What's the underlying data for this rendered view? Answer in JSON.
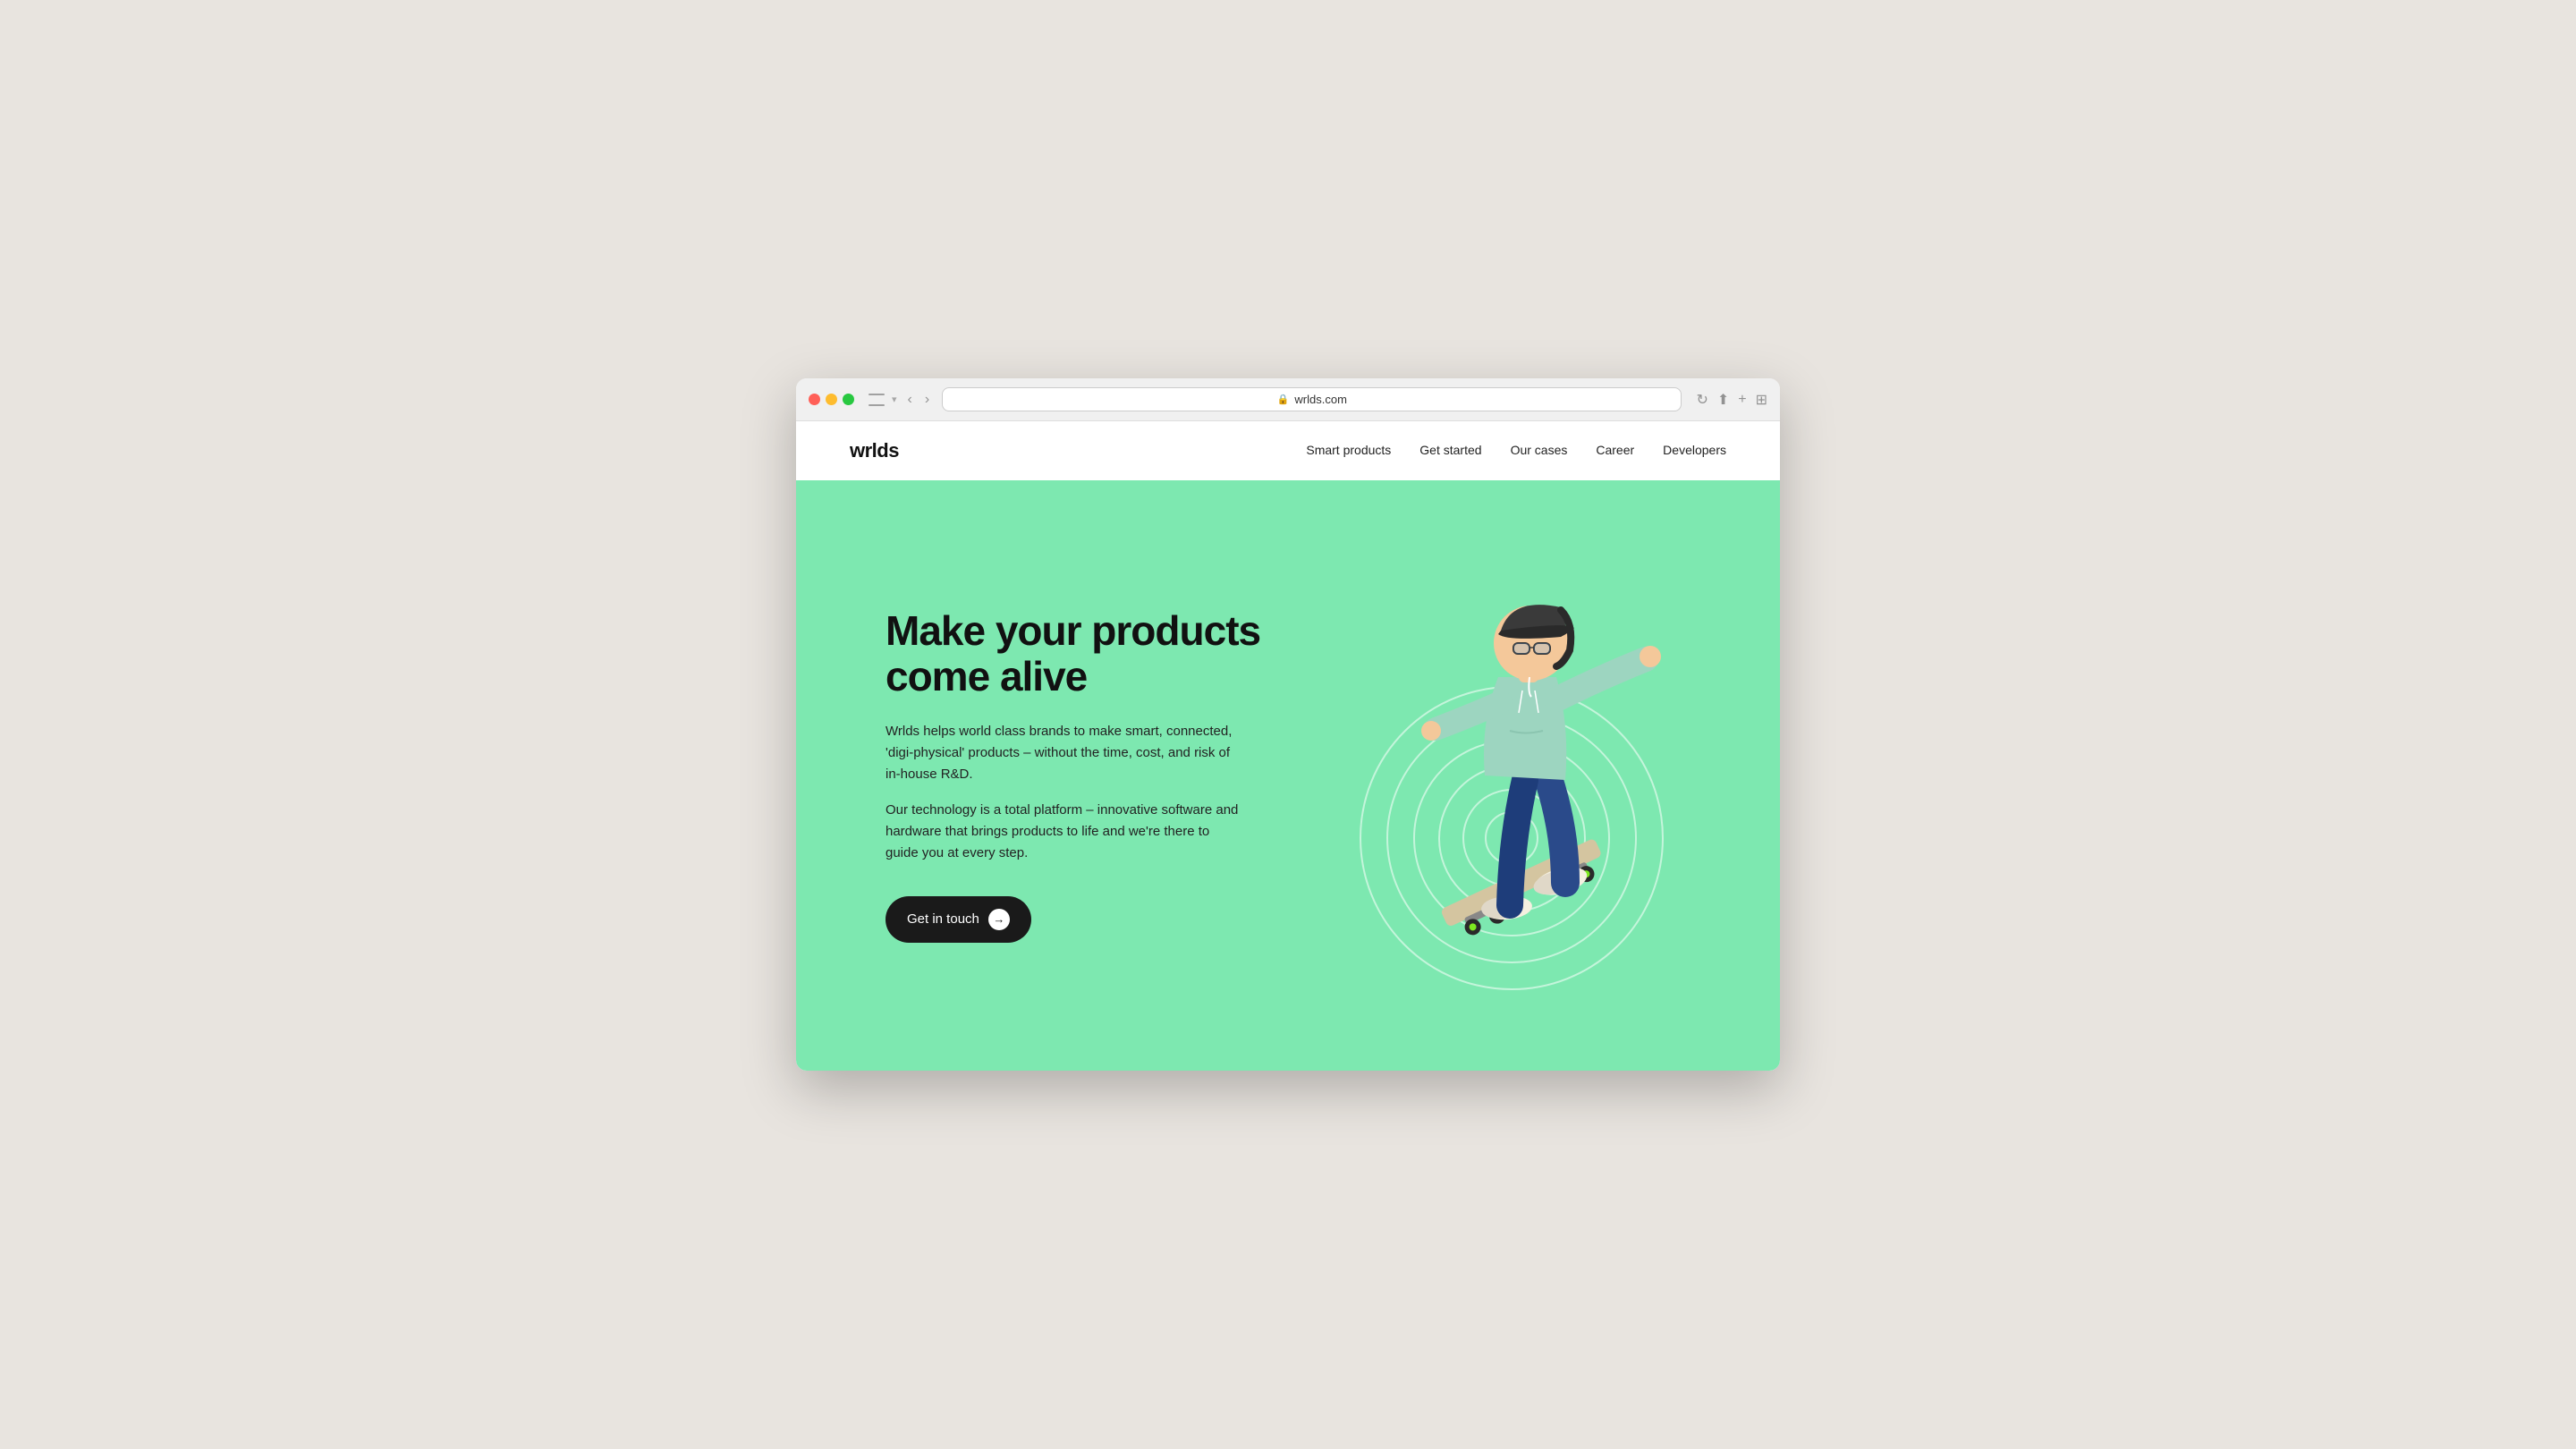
{
  "browser": {
    "url": "wrlds.com",
    "reload_label": "↻"
  },
  "nav": {
    "logo": "wrlds",
    "links": [
      {
        "label": "Smart products",
        "href": "#"
      },
      {
        "label": "Get started",
        "href": "#"
      },
      {
        "label": "Our cases",
        "href": "#"
      },
      {
        "label": "Career",
        "href": "#"
      },
      {
        "label": "Developers",
        "href": "#"
      }
    ]
  },
  "hero": {
    "title": "Make your products come alive",
    "desc1": "Wrlds helps world class brands to make smart, connected, 'digi-physical' products  – without the time, cost, and risk of in-house R&D.",
    "desc2": "Our technology is a total platform – innovative software and hardware that brings products to life and we're there to guide you at every step.",
    "cta_label": "Get in touch",
    "bg_color": "#7de8b0"
  }
}
